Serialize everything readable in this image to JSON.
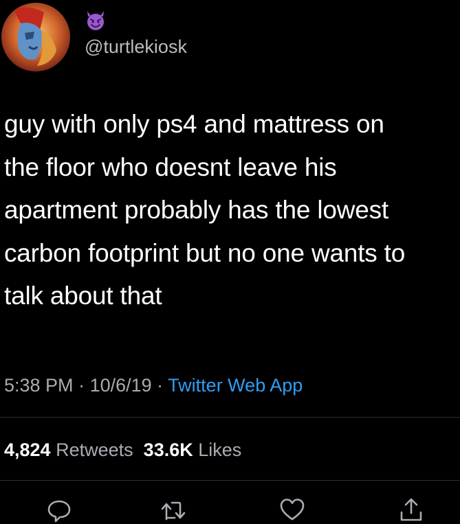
{
  "user": {
    "display_name_icon": "smiling-devil-emoji-icon",
    "handle": "@turtlekiosk"
  },
  "tweet": {
    "text": "guy with only ps4 and mattress on\nthe floor who doesnt leave his\napartment probably has the lowest\ncarbon footprint but no one wants to\ntalk about that",
    "time": "5:38 PM",
    "separator_1": " · ",
    "date": "10/6/19",
    "separator_2": " · ",
    "source": "Twitter Web App"
  },
  "stats": {
    "retweets_count": "4,824",
    "retweets_label": "Retweets",
    "likes_count": "33.6K",
    "likes_label": "Likes"
  },
  "actions": [
    "reply-icon",
    "retweet-icon",
    "like-icon",
    "share-icon"
  ],
  "colors": {
    "background": "#000000",
    "text": "#ffffff",
    "secondary_text": "#a9adb3",
    "link": "#2f9ef5",
    "divider": "#2c2f33",
    "emoji": "#9b59d0"
  }
}
